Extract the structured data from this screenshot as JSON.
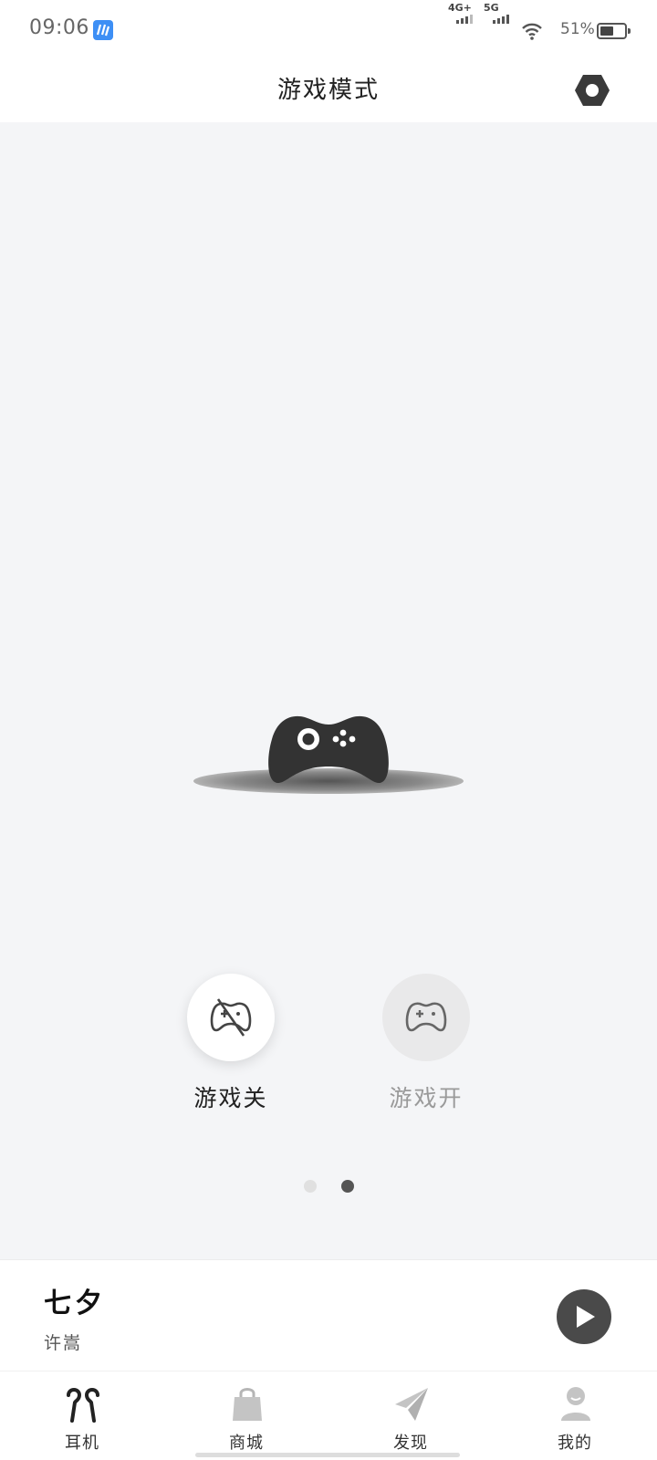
{
  "status": {
    "time": "09:06",
    "network_1": "4G+",
    "network_2": "5G",
    "battery": "51%"
  },
  "header": {
    "title": "游戏模式"
  },
  "modes": {
    "off_label": "游戏关",
    "on_label": "游戏开",
    "selected": "off"
  },
  "pager": {
    "page_count": 2,
    "active_index": 2
  },
  "player": {
    "song": "七夕",
    "artist": "许嵩"
  },
  "tabs": [
    {
      "label": "耳机",
      "icon": "earbuds-icon",
      "active": true
    },
    {
      "label": "商城",
      "icon": "shopping-bag-icon",
      "active": false
    },
    {
      "label": "发现",
      "icon": "paper-plane-icon",
      "active": false
    },
    {
      "label": "我的",
      "icon": "profile-icon",
      "active": false
    }
  ],
  "colors": {
    "background": "#f4f5f7",
    "icon_dark": "#3a3a3a",
    "accent_gray": "#9a9a9a"
  }
}
